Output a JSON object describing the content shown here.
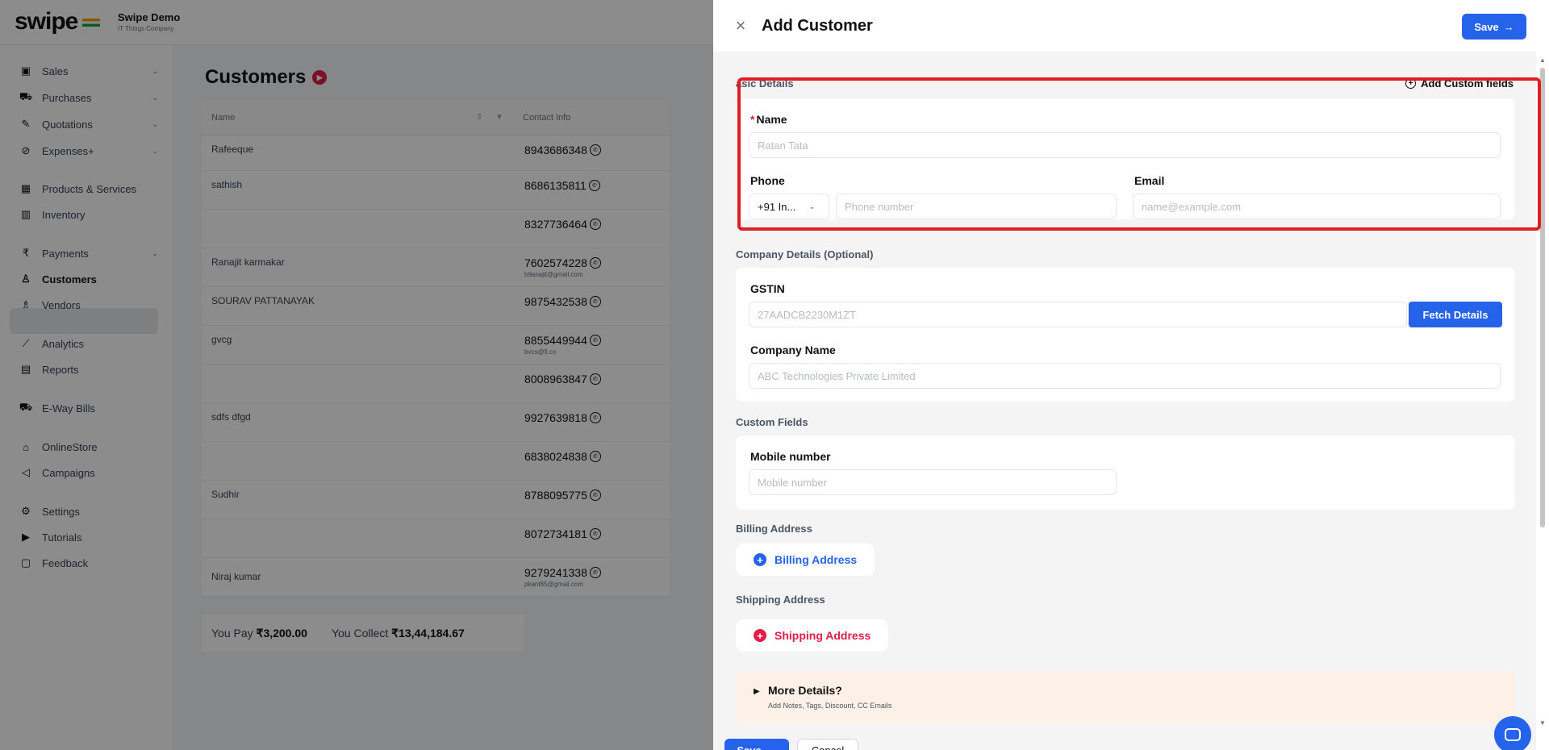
{
  "app": {
    "logo_text": "swipe",
    "company_name": "Swipe Demo",
    "company_sub": "IT Things Company"
  },
  "sidebar": {
    "items": [
      {
        "label": "Sales",
        "icon": "sales-icon",
        "glyph": "▣"
      },
      {
        "label": "Purchases",
        "icon": "cart-icon",
        "glyph": "🛒"
      },
      {
        "label": "Quotations",
        "icon": "pen-icon",
        "glyph": "✎"
      },
      {
        "label": "Expenses+",
        "icon": "tag-icon",
        "glyph": "⌂"
      },
      {
        "label": "Products & Services",
        "icon": "box-icon",
        "glyph": "▦"
      },
      {
        "label": "Inventory",
        "icon": "warehouse-icon",
        "glyph": "▥"
      },
      {
        "label": "Payments",
        "icon": "rupee-icon",
        "glyph": "₹"
      },
      {
        "label": "Customers",
        "icon": "user-icon",
        "glyph": "♙"
      },
      {
        "label": "Vendors",
        "icon": "users-icon",
        "glyph": "♗"
      },
      {
        "label": "Analytics",
        "icon": "chart-icon",
        "glyph": "⟋"
      },
      {
        "label": "Reports",
        "icon": "report-icon",
        "glyph": "▤"
      },
      {
        "label": "E-Way Bills",
        "icon": "truck-icon",
        "glyph": "⛟"
      },
      {
        "label": "OnlineStore",
        "icon": "store-icon",
        "glyph": "⌂"
      },
      {
        "label": "Campaigns",
        "icon": "megaphone-icon",
        "glyph": "📢"
      },
      {
        "label": "Settings",
        "icon": "gear-icon",
        "glyph": "⚙"
      },
      {
        "label": "Tutorials",
        "icon": "youtube-icon",
        "glyph": "▶"
      },
      {
        "label": "Feedback",
        "icon": "message-icon",
        "glyph": "▢"
      }
    ]
  },
  "customers": {
    "title": "Customers",
    "col_name": "Name",
    "col_contact": "Contact Info",
    "rows": [
      {
        "name": "Rafeeque",
        "phone": "8943686348",
        "email": ""
      },
      {
        "name": "sathish",
        "phone": "8686135811",
        "email": ""
      },
      {
        "name": "",
        "phone": "8327736464",
        "email": ""
      },
      {
        "name": "Ranajit karmakar",
        "phone": "7602574228",
        "email": "b9anajit@gmail.com"
      },
      {
        "name": "SOURAV PATTANAYAK",
        "phone": "9875432538",
        "email": ""
      },
      {
        "name": "gvcg",
        "phone": "8855449944",
        "email": "bvcs@fl.co"
      },
      {
        "name": "",
        "phone": "8008963847",
        "email": ""
      },
      {
        "name": "sdfs dfgd",
        "phone": "9927639818",
        "email": ""
      },
      {
        "name": "",
        "phone": "6838024838",
        "email": ""
      },
      {
        "name": "Sudhir",
        "phone": "8788095775",
        "email": ""
      },
      {
        "name": "",
        "phone": "8072734181",
        "email": ""
      },
      {
        "name": "Niraj kumar",
        "phone": "9279241338",
        "email": "pkant65@gmail.com"
      }
    ],
    "you_pay_label": "You Pay",
    "you_pay_value": "₹3,200.00",
    "you_collect_label": "You Collect",
    "you_collect_value": "₹13,44,184.67"
  },
  "drawer": {
    "title": "Add Customer",
    "save_label": "Save",
    "cancel_label": "Cancel",
    "basic": {
      "section_label": "asic Details",
      "add_custom_label": "Add Custom fields",
      "name_label": "Name",
      "name_placeholder": "Ratan Tata",
      "phone_label": "Phone",
      "country_code": "+91  In...",
      "phone_placeholder": "Phone number",
      "email_label": "Email",
      "email_placeholder": "name@example.com"
    },
    "company": {
      "section_label": "Company Details (Optional)",
      "gstin_label": "GSTIN",
      "gstin_placeholder": "27AADCB2230M1ZT",
      "fetch_label": "Fetch Details",
      "company_name_label": "Company Name",
      "company_name_placeholder": "ABC Technologies Private Limited"
    },
    "custom": {
      "section_label": "Custom Fields",
      "mobile_label": "Mobile number",
      "mobile_placeholder": "Mobile number"
    },
    "billing": {
      "section_label": "Billing Address",
      "button_label": "Billing Address"
    },
    "shipping": {
      "section_label": "Shipping Address",
      "button_label": "Shipping Address"
    },
    "more": {
      "title": "More Details?",
      "subtitle": "Add Notes, Tags, Discount, CC Emails"
    }
  },
  "colors": {
    "primary": "#2563eb",
    "danger": "#e11d48",
    "highlight": "#e11d24"
  }
}
